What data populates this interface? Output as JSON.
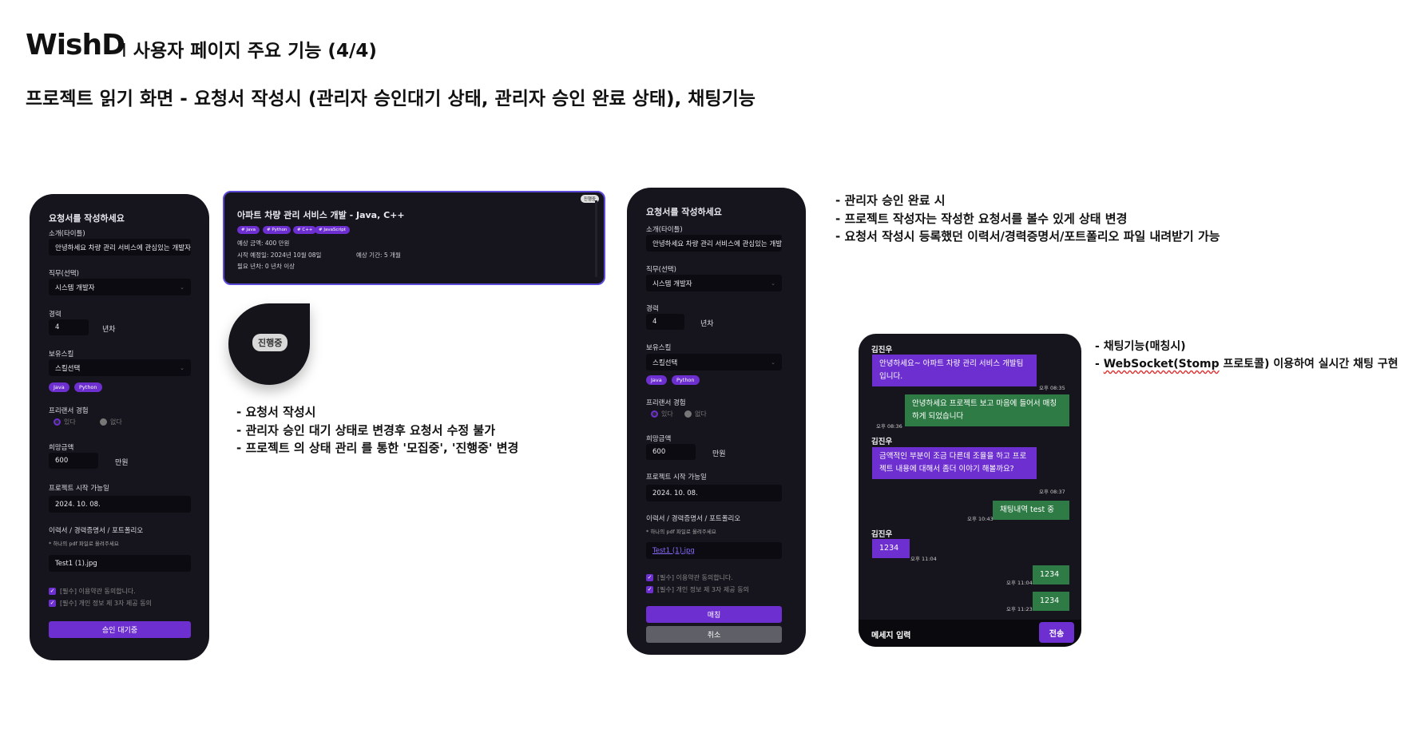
{
  "header": {
    "brand": "WishD",
    "divider": "I",
    "section": "사용자 페이지 주요 기능 (4/4)",
    "subtitle": "프로젝트 읽기 화면 - 요청서 작성시 (관리자 승인대기 상태, 관리자 승인 완료 상태), 채팅기능"
  },
  "form_left": {
    "title": "요청서를 작성하세요",
    "intro_label": "소개(타이틀)",
    "intro_value": "안녕하세요 차량 관리 서비스에 관심있는 개발자",
    "role_label": "직무(선택)",
    "role_value": "시스템 개발자",
    "career_label": "경력",
    "career_value": "4",
    "career_unit": "년차",
    "skills_label": "보유스킬",
    "skills_value": "스킬선택",
    "skill_chips": [
      "Java",
      "Python"
    ],
    "freelance_label": "프리랜서 경험",
    "radio_yes": "있다",
    "radio_no": "없다",
    "pay_label": "희망금액",
    "pay_value": "600",
    "pay_unit": "만원",
    "start_label": "프로젝트 시작 가능일",
    "start_value": "2024. 10. 08.",
    "files_label": "이력서 / 경력증명서 / 포트폴리오",
    "files_hint": "* 하나의 pdf 파일로 올려주세요",
    "file_value": "Test1 (1).jpg",
    "agree1": "[필수] 이용약관 동의합니다.",
    "agree2": "[필수] 개인 정보 제 3자 제공 동의",
    "submit_label": "승인 대기중"
  },
  "project_card": {
    "title": "아파트 차량 관리 서비스 개발 - Java, C++",
    "badge": "진행중",
    "tags": [
      "# Java",
      "# Python",
      "# C++",
      "# JavaScript"
    ],
    "budget": "예상 금액: 400 만원",
    "start": "시작 예정일: 2024년 10월 08일",
    "period": "예상 기간: 5 개월",
    "career": "필요 년차: 0 년차 이상"
  },
  "zoom": {
    "pill": "진행중"
  },
  "notes_1": [
    "요청서 작성시",
    "관리자 승인 대기 상태로 변경후 요청서 수정 불가",
    "프로젝트 의 상태 관리 를 통한 '모집중', '진행중' 변경"
  ],
  "form_right": {
    "title": "요청서를 작성하세요",
    "intro_label": "소개(타이틀)",
    "intro_value": "안녕하세요 차량 관리 서비스에 관심있는 개발자",
    "role_label": "직무(선택)",
    "role_value": "시스템 개발자",
    "career_label": "경력",
    "career_value": "4",
    "career_unit": "년차",
    "skills_label": "보유스킬",
    "skills_value": "스킬선택",
    "skill_chips": [
      "Java",
      "Python"
    ],
    "freelance_label": "프리랜서 경험",
    "radio_yes": "있다",
    "radio_no": "없다",
    "pay_label": "희망금액",
    "pay_value": "600",
    "pay_unit": "만원",
    "start_label": "프로젝트 시작 가능일",
    "start_value": "2024. 10. 08.",
    "files_label": "이력서 / 경력증명서 / 포트폴리오",
    "files_hint": "* 하나의 pdf 파일로 올려주세요",
    "file_value": "Test1 (1).jpg",
    "agree1": "[필수] 이용약관 동의합니다.",
    "agree2": "[필수] 개인 정보 제 3자 제공 동의",
    "match_label": "매칭",
    "cancel_label": "취소"
  },
  "notes_2": [
    "관리자 승인 완료 시",
    "프로젝트 작성자는 작성한 요청서를 볼수 있게 상태 변경",
    "요청서 작성시 등록했던 이력서/경력증명서/포트폴리오 파일 내려받기 가능"
  ],
  "chat": {
    "name": "김진우",
    "msg1": "안녕하세요~ 아파트 차량 관리 서비스 개발팀 입니다.",
    "time1": "오후 08:35",
    "msg2": "안녕하세요 프로젝트 보고 마음에 들어서 매칭하게 되었습니다",
    "time2": "오후 08:36",
    "msg3": "금액적인 부분이 조금 다른데 조율을 하고 프로젝트 내용에 대해서 좀더 이야기 해볼까요?",
    "time3": "오후 08:37",
    "msg4": "채팅내역 test 중",
    "time4": "오후 10:43",
    "msg5": "1234",
    "time5": "오후 11:04",
    "msg6": "1234",
    "time6": "오후 11:04",
    "msg7": "1234",
    "time7": "오후 11:23",
    "input_placeholder": "메세지 입력",
    "send_label": "전송"
  },
  "notes_3": {
    "line1": "채팅기능(매칭시)",
    "line2_tech": "WebSocket(Stomp",
    "line2_rest": " 프로토콜) 이용하여 실시간 채팅 구현"
  },
  "colors": {
    "accent": "#6d2fcf",
    "panel": "#16151e",
    "green": "#2f7b45"
  }
}
